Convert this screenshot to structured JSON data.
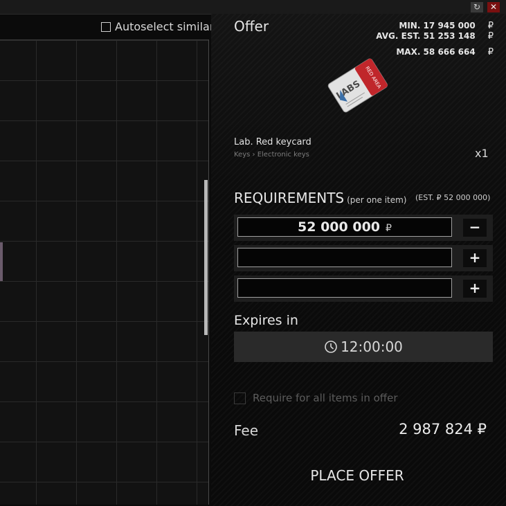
{
  "window": {
    "refresh_icon": "↻",
    "close_icon": "✕"
  },
  "left": {
    "autoselect_label": "Autoselect similar"
  },
  "offer": {
    "title": "Offer",
    "prices": {
      "min_label": "MIN. 17 945 000",
      "avg_label": "AVG. EST. 51 253 148",
      "max_label": "MAX. 58 666 664",
      "currency": "₽"
    },
    "item": {
      "name": "Lab. Red keycard",
      "category": "Keys › Electronic keys",
      "quantity": "x1",
      "card_text": "LABS",
      "card_tag": "RED AREA",
      "accent_color": "#c0262b"
    },
    "requirements": {
      "title": "REQUIREMENTS",
      "subtitle": "(per one item)",
      "estimate": "(EST. ₽ 52 000 000)",
      "rows": [
        {
          "value": "52 000 000",
          "currency": "₽",
          "button": "−"
        },
        {
          "value": "",
          "currency": "",
          "button": "+"
        },
        {
          "value": "",
          "currency": "",
          "button": "+"
        }
      ]
    },
    "expires": {
      "title": "Expires in",
      "time": "12:00:00"
    },
    "require_all_label": "Require for all items in offer",
    "fee": {
      "label": "Fee",
      "value": "2 987 824 ₽"
    },
    "place_offer_label": "PLACE OFFER"
  }
}
